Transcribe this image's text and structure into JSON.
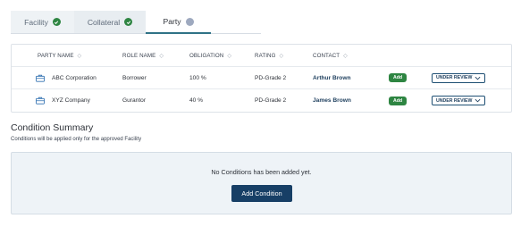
{
  "tabs": [
    {
      "label": "Facility",
      "status_icon": "check-circle-icon",
      "status_color": "#2e8542"
    },
    {
      "label": "Collateral",
      "status_icon": "check-circle-icon",
      "status_color": "#2e8542"
    },
    {
      "label": "Party",
      "status_icon": "pending-dot-icon",
      "status_color": "#9ea9bf",
      "active": true
    }
  ],
  "table": {
    "headers": {
      "party_name": "PARTY NAME",
      "role_name": "ROLE NAME",
      "obligation": "OBLIGATION",
      "rating": "RATING",
      "contact": "CONTACT"
    },
    "rows": [
      {
        "party_name": "ABC Corporation",
        "role_name": "Borrower",
        "obligation": "100 %",
        "rating": "PD-Grade 2",
        "contact": "Arthur Brown",
        "add_label": "Add",
        "status": "UNDER REVIEW"
      },
      {
        "party_name": "XYZ Company",
        "role_name": "Gurantor",
        "obligation": "40 %",
        "rating": "PD-Grade 2",
        "contact": "James Brown",
        "add_label": "Add",
        "status": "UNDER REVIEW"
      }
    ]
  },
  "conditions": {
    "title": "Condition Summary",
    "subtitle": "Conditions will be applied only for the approved Facility",
    "empty_message": "No Conditions has been added yet.",
    "add_button": "Add Condition"
  },
  "colors": {
    "accent": "#173f66",
    "success": "#2e8542",
    "tab_active_underline": "#2f7286"
  }
}
